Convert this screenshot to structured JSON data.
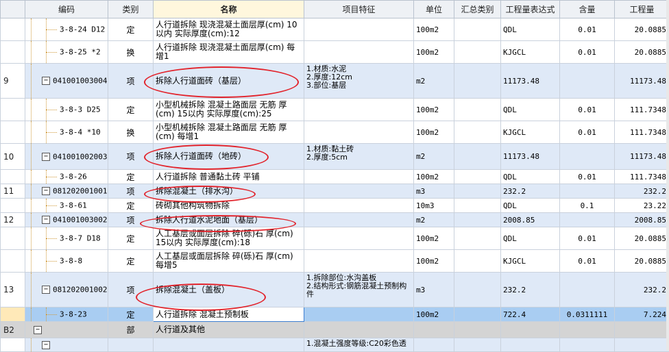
{
  "headers": {
    "num": "",
    "code": "编码",
    "type": "类别",
    "name": "名称",
    "feature": "项目特征",
    "unit": "单位",
    "summary": "汇总类别",
    "expr": "工程量表达式",
    "content": "含量",
    "qty": "工程量"
  },
  "rows": [
    {
      "kind": "sub",
      "num": "",
      "code": "3-8-24 D12",
      "type": "定",
      "name": "人行道拆除 现浇混凝土面层厚(cm) 10以内  实际厚度(cm):12",
      "feature": "",
      "unit": "100m2",
      "summary": "",
      "expr": "QDL",
      "content": "0.01",
      "qty": "20.0885"
    },
    {
      "kind": "sub",
      "num": "",
      "code": "3-8-25 *2",
      "type": "换",
      "name": "人行道拆除 现浇混凝土面层厚(cm) 每增1",
      "feature": "",
      "unit": "100m2",
      "summary": "",
      "expr": "KJGCL",
      "content": "0.01",
      "qty": "20.0885"
    },
    {
      "kind": "dept",
      "num": "9",
      "code": "041001003004",
      "type": "项",
      "name": "拆除人行道面砖（基层）",
      "feature": "1.材质:水泥\n2.厚度:12cm\n3.部位:基层",
      "unit": "m2",
      "summary": "",
      "expr": "11173.48",
      "content": "",
      "qty": "11173.48"
    },
    {
      "kind": "sub",
      "num": "",
      "code": "3-8-3 D25",
      "type": "定",
      "name": "小型机械拆除 混凝土路面层 无筋 厚(cm) 15以内  实际厚度(cm):25",
      "feature": "",
      "unit": "100m2",
      "summary": "",
      "expr": "QDL",
      "content": "0.01",
      "qty": "111.7348"
    },
    {
      "kind": "sub",
      "num": "",
      "code": "3-8-4 *10",
      "type": "换",
      "name": "小型机械拆除 混凝土路面层 无筋 厚(cm) 每增1",
      "feature": "",
      "unit": "100m2",
      "summary": "",
      "expr": "KJGCL",
      "content": "0.01",
      "qty": "111.7348"
    },
    {
      "kind": "dept",
      "num": "10",
      "code": "041001002003",
      "type": "项",
      "name": "拆除人行道面砖（地砖）",
      "feature": "1.材质:黏土砖\n2.厚度:5cm",
      "unit": "m2",
      "summary": "",
      "expr": "11173.48",
      "content": "",
      "qty": "11173.48"
    },
    {
      "kind": "sub",
      "num": "",
      "code": "3-8-26",
      "type": "定",
      "name": "人行道拆除 普通黏土砖 平铺",
      "feature": "",
      "unit": "100m2",
      "summary": "",
      "expr": "QDL",
      "content": "0.01",
      "qty": "111.7348"
    },
    {
      "kind": "dept",
      "num": "11",
      "code": "081202001001",
      "type": "项",
      "name": "拆除混凝土（排水沟）",
      "feature": "",
      "unit": "m3",
      "summary": "",
      "expr": "232.2",
      "content": "",
      "qty": "232.2"
    },
    {
      "kind": "sub",
      "num": "",
      "code": "3-8-61",
      "type": "定",
      "name": "砖砌其他构筑物拆除",
      "feature": "",
      "unit": "10m3",
      "summary": "",
      "expr": "QDL",
      "content": "0.1",
      "qty": "23.22"
    },
    {
      "kind": "dept",
      "num": "12",
      "code": "041001003002",
      "type": "项",
      "name": "拆除人行道水泥地面（基层）",
      "feature": "",
      "unit": "m2",
      "summary": "",
      "expr": "2008.85",
      "content": "",
      "qty": "2008.85"
    },
    {
      "kind": "sub",
      "num": "",
      "code": "3-8-7 D18",
      "type": "定",
      "name": "人工基层或面层拆除 碎(砾)石 厚(cm) 15以内  实际厚度(cm):18",
      "feature": "",
      "unit": "100m2",
      "summary": "",
      "expr": "QDL",
      "content": "0.01",
      "qty": "20.0885"
    },
    {
      "kind": "sub",
      "num": "",
      "code": "3-8-8",
      "type": "定",
      "name": "人工基层或面层拆除 碎(砾)石 厚(cm) 每增5",
      "feature": "",
      "unit": "100m2",
      "summary": "",
      "expr": "KJGCL",
      "content": "0.01",
      "qty": "20.0885"
    },
    {
      "kind": "dept",
      "num": "13",
      "code": "081202001002",
      "type": "项",
      "name": "拆除混凝土（盖板）",
      "feature": "1.拆除部位:水沟盖板\n2.结构形式:钢筋混凝土预制构件",
      "unit": "m3",
      "summary": "",
      "expr": "232.2",
      "content": "",
      "qty": "232.2"
    },
    {
      "kind": "sel",
      "num": "",
      "code": "3-8-23",
      "type": "定",
      "name": "人行道拆除 混凝土预制板",
      "feature": "",
      "unit": "100m2",
      "summary": "",
      "expr": "722.4",
      "content": "0.0311111",
      "qty": "7.224"
    },
    {
      "kind": "part",
      "num": "B2",
      "code": "",
      "type": "部",
      "name": "人行道及其他",
      "feature": "",
      "unit": "",
      "summary": "",
      "expr": "",
      "content": "",
      "qty": ""
    },
    {
      "kind": "dept",
      "num": "",
      "code": "",
      "type": "",
      "name": "",
      "feature": "1.混凝土强度等级:C20彩色透",
      "unit": "",
      "summary": "",
      "expr": "",
      "content": "",
      "qty": ""
    }
  ],
  "annotation_color": "#e2232b"
}
